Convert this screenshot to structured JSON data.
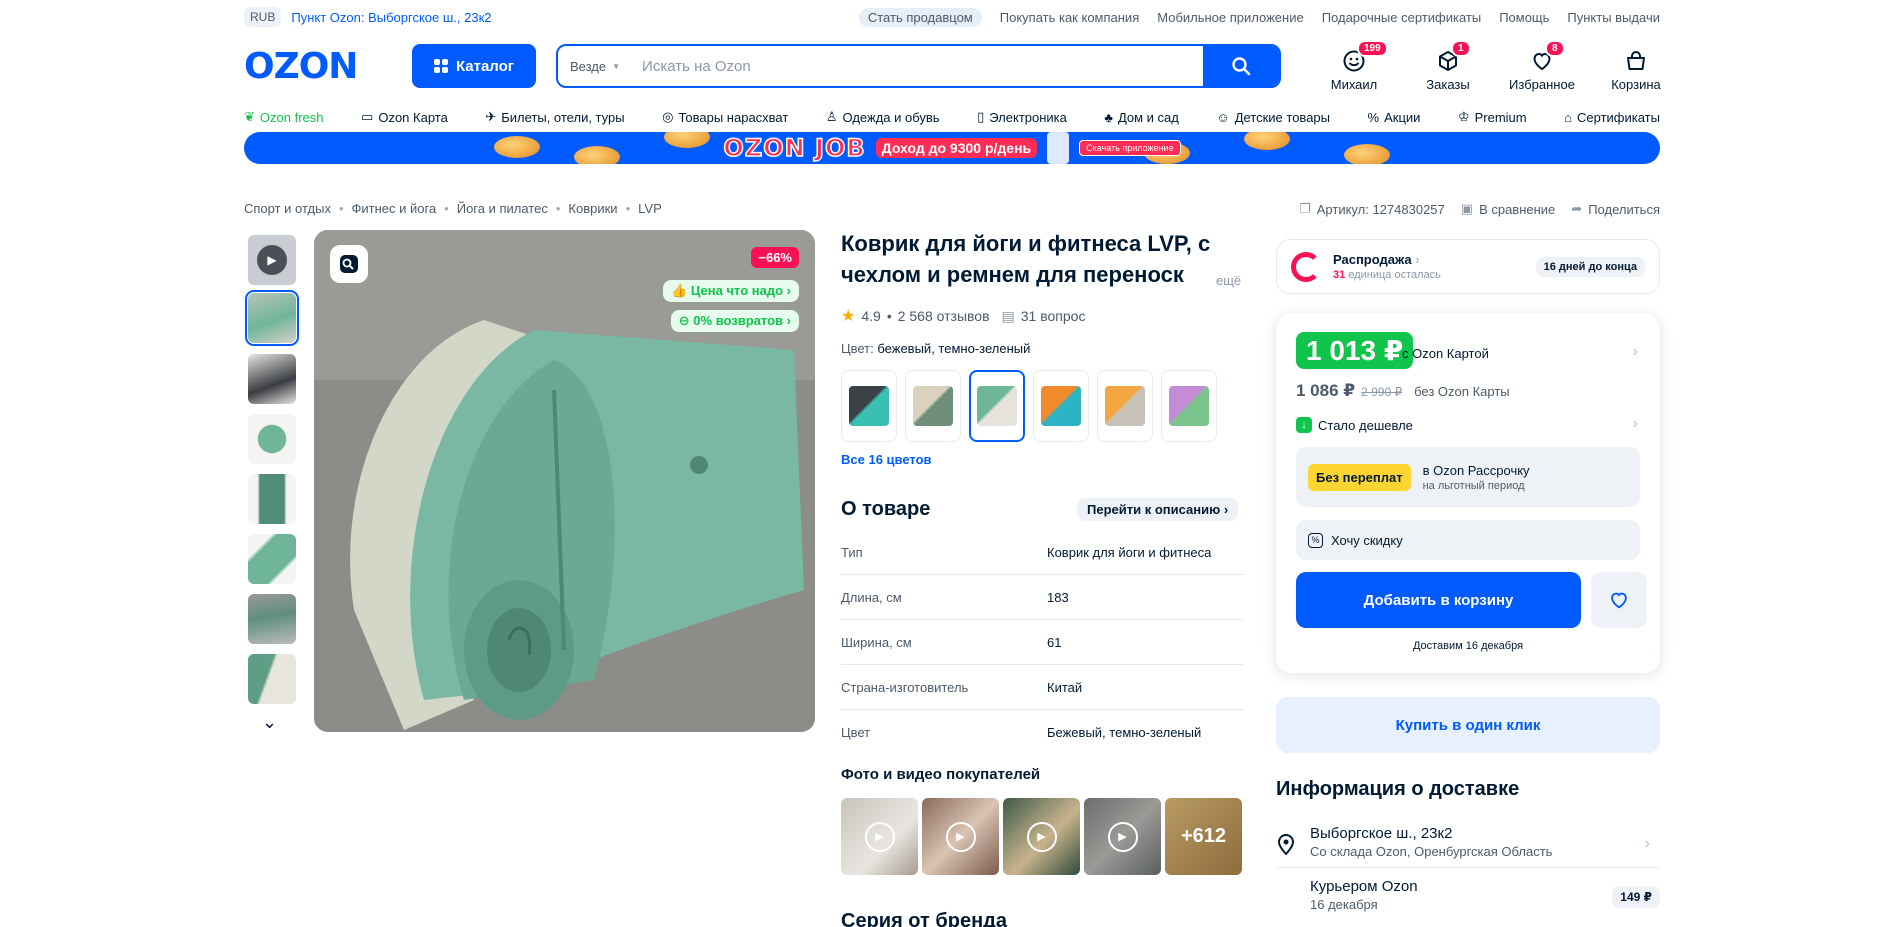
{
  "topbar": {
    "currency": "RUB",
    "pickup_point": "Пункт Ozon: Выборгское ш., 23к2",
    "links": [
      "Стать продавцом",
      "Покупать как компания",
      "Мобильное приложение",
      "Подарочные сертификаты",
      "Помощь",
      "Пункты выдачи"
    ]
  },
  "header": {
    "logo": "OZON",
    "catalog_label": "Каталог",
    "search_scope": "Везде",
    "search_placeholder": "Искать на Ozon",
    "user_label": "Михаил",
    "user_badge": "199",
    "orders_label": "Заказы",
    "orders_badge": "1",
    "favorites_label": "Избранное",
    "favorites_badge": "8",
    "cart_label": "Корзина"
  },
  "nav": [
    {
      "label": "Ozon fresh",
      "icon": "leaf-icon"
    },
    {
      "label": "Ozon Карта",
      "icon": "card-icon"
    },
    {
      "label": "Билеты, отели, туры",
      "icon": "plane-icon"
    },
    {
      "label": "Товары нарасхват",
      "icon": "fire-icon"
    },
    {
      "label": "Одежда и обувь",
      "icon": "shirt-icon"
    },
    {
      "label": "Электроника",
      "icon": "phone-icon"
    },
    {
      "label": "Дом и сад",
      "icon": "plant-icon"
    },
    {
      "label": "Детские товары",
      "icon": "baby-icon"
    },
    {
      "label": "Акции",
      "icon": "percent-icon"
    },
    {
      "label": "Premium",
      "icon": "crown-icon"
    },
    {
      "label": "Сертификаты",
      "icon": "gift-icon"
    }
  ],
  "banner": {
    "title": "OZON JOB",
    "pill": "Доход до 9300 р/день",
    "small": "Скачать приложение"
  },
  "breadcrumbs": [
    "Спорт и отдых",
    "Фитнес и йога",
    "Йога и пилатес",
    "Коврики",
    "LVP"
  ],
  "meta": {
    "article": "Артикул: 1274830257",
    "compare": "В сравнение",
    "share": "Поделиться"
  },
  "product": {
    "title": "Коврик для йоги и фитнеса LVP, с чехлом и ремнем для переноск",
    "more": "ещё",
    "rating": "4.9",
    "reviews": "2 568 отзывов",
    "questions": "31 вопрос",
    "color_label": "Цвет:",
    "color_value": "бежевый, темно-зеленый",
    "all_colors": "Все 16 цветов",
    "discount_badge": "−66%",
    "tag_price": "Цена что надо",
    "tag_returns": "0% возвратов",
    "swatches": [
      {
        "c1": "#3c4148",
        "c2": "#39c0b0"
      },
      {
        "c1": "#d8d2bf",
        "c2": "#6f8f78"
      },
      {
        "c1": "#6fb59a",
        "c2": "#e6e3dc"
      },
      {
        "c1": "#f08a2a",
        "c2": "#2cb3c4"
      },
      {
        "c1": "#f3a640",
        "c2": "#c7c2b8"
      },
      {
        "c1": "#c68bd6",
        "c2": "#7bc48e"
      }
    ]
  },
  "about": {
    "heading": "О товаре",
    "goto": "Перейти к описанию",
    "specs": [
      {
        "k": "Тип",
        "v": "Коврик для йоги и фитнеса"
      },
      {
        "k": "Длина, см",
        "v": "183"
      },
      {
        "k": "Ширина, см",
        "v": "61"
      },
      {
        "k": "Страна-изготовитель",
        "v": "Китай"
      },
      {
        "k": "Цвет",
        "v": "Бежевый, темно-зеленый"
      }
    ]
  },
  "photos": {
    "heading": "Фото и видео покупателей",
    "more_count": "+612"
  },
  "series_heading": "Серия от бренда",
  "sale": {
    "title": "Распродажа",
    "count": "31",
    "count_text": "единица осталась",
    "days": "16 дней до конца"
  },
  "price": {
    "card_price": "1 013 ₽",
    "card_label": "с Ozon Картой",
    "regular": "1 086 ₽",
    "old": "2 990 ₽",
    "regular_label": "без Ozon Карты",
    "cheaper": "Стало дешевле",
    "installment_pill": "Без переплат",
    "installment_title": "в Ozon Рассрочку",
    "installment_sub": "на льготный период",
    "want_discount": "Хочу скидку",
    "add_to_cart": "Добавить в корзину",
    "delivery_date": "Доставим 16 декабря",
    "one_click": "Купить в один клик"
  },
  "delivery": {
    "heading": "Информация о доставке",
    "address": "Выборгское ш., 23к2",
    "address_sub": "Со склада Ozon, Оренбургская Область",
    "courier": "Курьером Ozon",
    "courier_date": "16 декабря",
    "courier_price": "149 ₽"
  },
  "colors": {
    "brand": "#005bff",
    "sale_red": "#f91155",
    "green": "#10c44c"
  }
}
